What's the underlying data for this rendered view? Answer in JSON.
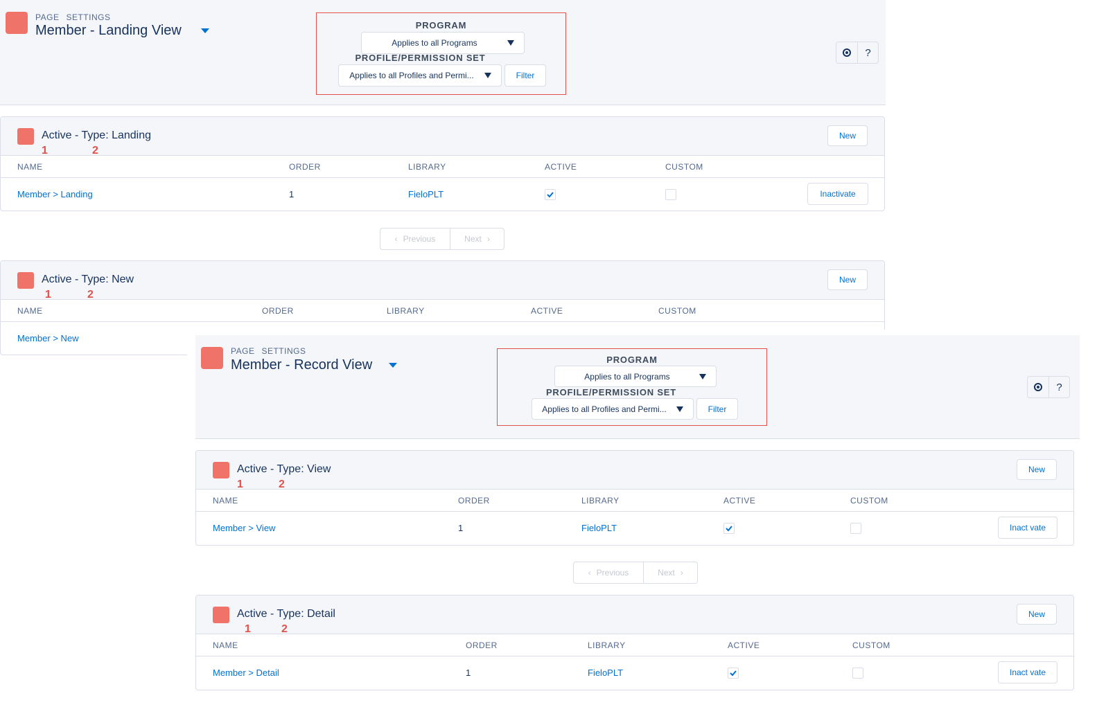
{
  "landing_view": {
    "header": {
      "eyebrow": [
        "PAGE",
        "SETTINGS"
      ],
      "title": "Member - Landing View"
    },
    "filters": {
      "program_label": "PROGRAM",
      "program_value": "Applies to all Programs",
      "profile_label": "PROFILE/PERMISSION SET",
      "profile_value": "Applies to all Profiles and Permi...",
      "filter_button": "Filter"
    },
    "help_buttons": [
      "settings-icon",
      "?"
    ],
    "cards": [
      {
        "title": "Active - Type: Landing",
        "markers": [
          "1",
          "2"
        ],
        "new_button": "New",
        "columns": [
          "NAME",
          "ORDER",
          "LIBRARY",
          "ACTIVE",
          "CUSTOM"
        ],
        "rows": [
          {
            "name": "Member > Landing",
            "order": "1",
            "library": "FieloPLT",
            "active": true,
            "custom": false,
            "action": "Inactivate"
          }
        ]
      },
      {
        "title": "Active - Type: New",
        "markers": [
          "1",
          "2"
        ],
        "new_button": "New",
        "columns": [
          "NAME",
          "ORDER",
          "LIBRARY",
          "ACTIVE",
          "CUSTOM"
        ],
        "rows": [
          {
            "name": "Member > New"
          }
        ]
      }
    ],
    "pager": {
      "previous": "Previous",
      "next": "Next"
    }
  },
  "record_view": {
    "header": {
      "eyebrow": [
        "PAGE",
        "SETTINGS"
      ],
      "title": "Member - Record View"
    },
    "filters": {
      "program_label": "PROGRAM",
      "program_value": "Applies to all Programs",
      "profile_label": "PROFILE/PERMISSION SET",
      "profile_value": "Applies to all Profiles and Permi...",
      "filter_button": "Filter"
    },
    "help_buttons": [
      "settings-icon",
      "?"
    ],
    "cards": [
      {
        "title": "Active - Type: View",
        "markers": [
          "1",
          "2"
        ],
        "new_button": "New",
        "columns": [
          "NAME",
          "ORDER",
          "LIBRARY",
          "ACTIVE",
          "CUSTOM"
        ],
        "rows": [
          {
            "name": "Member > View",
            "order": "1",
            "library": "FieloPLT",
            "active": true,
            "custom": false,
            "action": "Inact vate"
          }
        ]
      },
      {
        "title": "Active - Type: Detail",
        "markers": [
          "1",
          "2"
        ],
        "new_button": "New",
        "columns": [
          "NAME",
          "ORDER",
          "LIBRARY",
          "ACTIVE",
          "CUSTOM"
        ],
        "rows": [
          {
            "name": "Member > Detail",
            "order": "1",
            "library": "FieloPLT",
            "active": true,
            "custom": false,
            "action": "Inact vate"
          }
        ]
      }
    ],
    "pager": {
      "previous": "Previous",
      "next": "Next"
    }
  },
  "colors": {
    "brand_icon": "#f0736a",
    "highlight_border": "#e0524b",
    "link": "#0070d2",
    "header_bg": "#f4f6f9"
  }
}
